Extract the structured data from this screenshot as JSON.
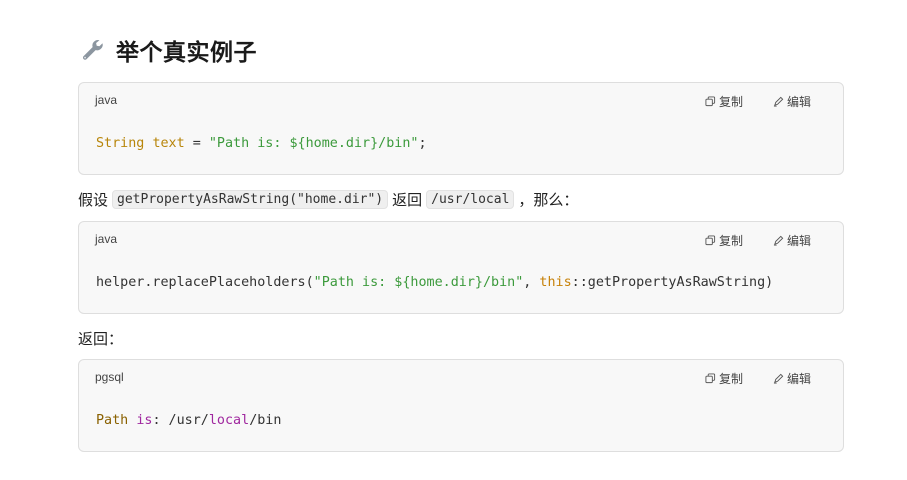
{
  "heading": {
    "icon": "wrench-icon",
    "title": "举个真实例子"
  },
  "actions": {
    "copy_label": "复制",
    "edit_label": "编辑"
  },
  "block1": {
    "lang": "java",
    "code": {
      "type": "String",
      "var": "text",
      "eq": " = ",
      "str": "\"Path is: ${home.dir}/bin\"",
      "end": ";"
    }
  },
  "para1": {
    "prefix": "假设",
    "code1": "getPropertyAsRawString(\"home.dir\")",
    "mid": "返回",
    "code2": "/usr/local",
    "suffix": "，那么："
  },
  "block2": {
    "lang": "java",
    "code": {
      "call": "helper.replacePlaceholders(",
      "str": "\"Path is: ${home.dir}/bin\"",
      "comma": ", ",
      "this": "this",
      "ref": "::getPropertyAsRawString)"
    }
  },
  "para2": {
    "text": "返回："
  },
  "block3": {
    "lang": "pgsql",
    "code": {
      "w1": "Path",
      "sp1": " ",
      "w2": "is",
      "rest1": ": /usr/",
      "w3": "local",
      "rest2": "/bin"
    }
  },
  "colors": {
    "keyword": "#b8860b",
    "string": "#3c9a3c",
    "purple": "#a0289f"
  }
}
